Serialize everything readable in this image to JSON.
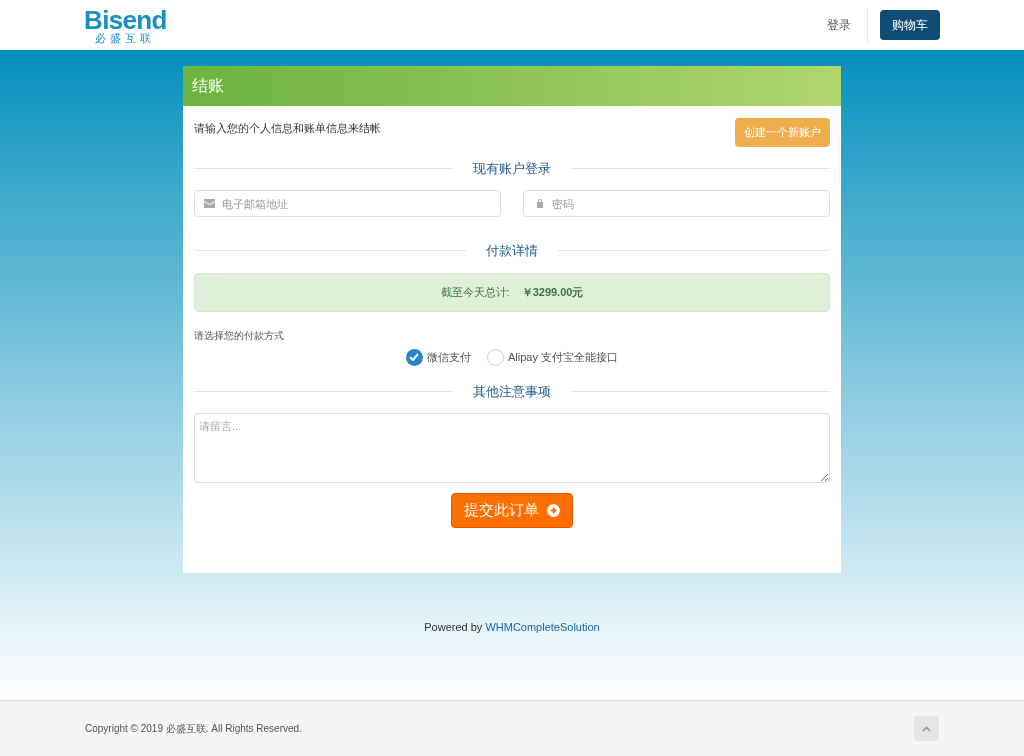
{
  "header": {
    "logo": "Bisend",
    "logo_subtitle": "必盛互联",
    "login": "登录",
    "cart": "购物车"
  },
  "checkout": {
    "title": "结账",
    "intro": "请输入您的个人信息和账单信息来结帐",
    "create_account": "创建一个新账户",
    "login_section": "现有账户登录",
    "email": {
      "placeholder": "电子邮箱地址"
    },
    "password": {
      "placeholder": "密码"
    },
    "payment_section": "付款详情",
    "total_label": "截至今天总计:",
    "total_value": "￥3299.00元",
    "payment_prompt": "请选择您的付款方式",
    "payment_methods": [
      {
        "label": "微信支付",
        "selected": true
      },
      {
        "label": "Alipay 支付宝全能接口",
        "selected": false
      }
    ],
    "notes_section": "其他注意事项",
    "notes": {
      "placeholder": "请留言..."
    },
    "submit": "提交此订单"
  },
  "powered": {
    "text": "Powered by",
    "link": "WHMCompleteSolution"
  },
  "footer": {
    "copyright": "Copyright © 2019 必盛互联. All Rights Reserved."
  }
}
